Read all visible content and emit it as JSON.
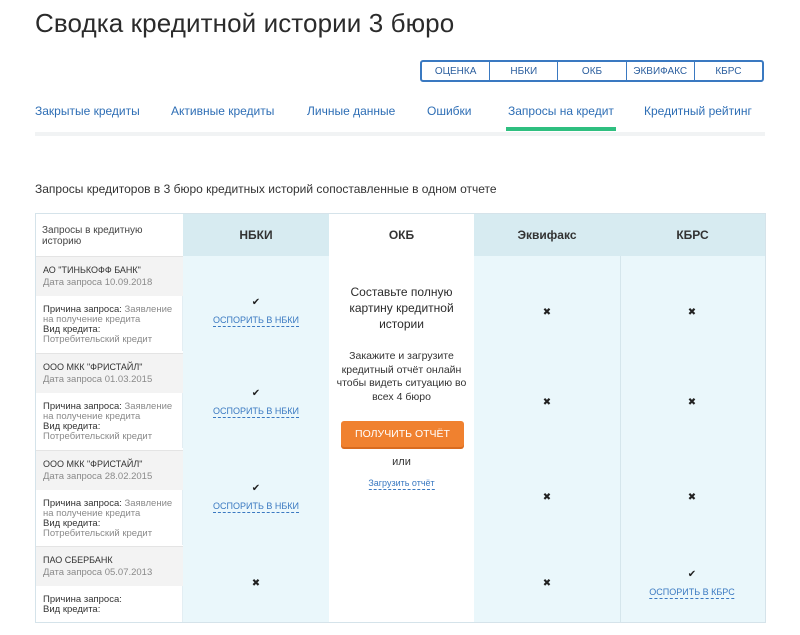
{
  "title": "Сводка кредитной истории 3 бюро",
  "bureau_switch": [
    "ОЦЕНКА",
    "НБКИ",
    "ОКБ",
    "ЭКВИФАКС",
    "КБРС"
  ],
  "tabs": [
    {
      "label": "Закрытые кредиты"
    },
    {
      "label": "Активные кредиты"
    },
    {
      "label": "Личные данные"
    },
    {
      "label": "Ошибки"
    },
    {
      "label": "Запросы на кредит",
      "active": true
    },
    {
      "label": "Кредитный рейтинг"
    }
  ],
  "section_caption": "Запросы кредиторов в 3 бюро кредитных историй сопоставленные в одном отчете",
  "table": {
    "corner_header": "Запросы в кредитную историю",
    "bureaus": [
      "НБКИ",
      "ОКБ",
      "Эквифакс",
      "КБРС"
    ],
    "reason_label": "Причина запроса:",
    "type_label": "Вид кредита:",
    "rows": [
      {
        "creditor": "АО \"ТИНЬКОФФ БАНК\"",
        "date": "Дата запроса 10.09.2018",
        "reason": "Заявление на получение кредита",
        "type": "Потребительский кредит",
        "nbki": "✔",
        "nbki_link": "ОСПОРИТЬ В НБКИ",
        "equifax": "✖",
        "kbrs": "✖",
        "kbrs_link": ""
      },
      {
        "creditor": "ООО МКК \"ФРИСТАЙЛ\"",
        "date": "Дата запроса 01.03.2015",
        "reason": "Заявление на получение кредита",
        "type": "Потребительский кредит",
        "nbki": "✔",
        "nbki_link": "ОСПОРИТЬ В НБКИ",
        "equifax": "✖",
        "kbrs": "✖",
        "kbrs_link": ""
      },
      {
        "creditor": "ООО МКК \"ФРИСТАЙЛ\"",
        "date": "Дата запроса 28.02.2015",
        "reason": "Заявление на получение кредита",
        "type": "Потребительский кредит",
        "nbki": "✔",
        "nbki_link": "ОСПОРИТЬ В НБКИ",
        "equifax": "✖",
        "kbrs": "✖",
        "kbrs_link": ""
      },
      {
        "creditor": "ПАО СБЕРБАНК",
        "date": "Дата запроса 05.07.2013",
        "reason": "",
        "type": "",
        "nbki": "✖",
        "nbki_link": "",
        "equifax": "✖",
        "kbrs": "✔",
        "kbrs_link": "ОСПОРИТЬ В КБРС"
      }
    ]
  },
  "promo": {
    "title": "Составьте полную картину кредитной истории",
    "text": "Закажите и загрузите кредитный отчёт онлайн чтобы видеть ситуацию во всех 4 бюро",
    "button": "ПОЛУЧИТЬ ОТЧЁТ",
    "or": "или",
    "upload": "Загрузить отчёт"
  },
  "colors": {
    "accent": "#3a79c1",
    "active_tab": "#2fbf80",
    "button": "#f0812f",
    "header_bg": "#d7ebf1",
    "column_bg": "#eaf7fb"
  }
}
